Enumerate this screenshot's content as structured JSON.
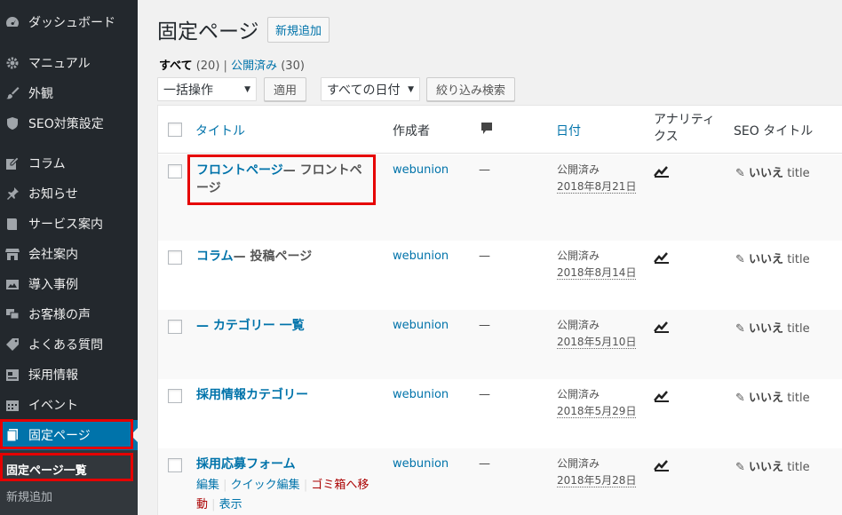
{
  "sidebar": {
    "items": [
      {
        "label": "ダッシュボード",
        "icon": "dashboard-icon"
      },
      {
        "label": "マニュアル",
        "icon": "gear-icon"
      },
      {
        "label": "外観",
        "icon": "paintbrush-icon"
      },
      {
        "label": "SEO対策設定",
        "icon": "shield-icon"
      },
      {
        "label": "コラム",
        "icon": "edit-icon"
      },
      {
        "label": "お知らせ",
        "icon": "pin-icon"
      },
      {
        "label": "サービス案内",
        "icon": "book-icon"
      },
      {
        "label": "会社案内",
        "icon": "store-icon"
      },
      {
        "label": "導入事例",
        "icon": "images-icon"
      },
      {
        "label": "お客様の声",
        "icon": "chat-icon"
      },
      {
        "label": "よくある質問",
        "icon": "tag-icon"
      },
      {
        "label": "採用情報",
        "icon": "id-card-icon"
      },
      {
        "label": "イベント",
        "icon": "calendar-icon"
      },
      {
        "label": "固定ページ",
        "icon": "pages-icon"
      }
    ],
    "submenu": {
      "all_pages": "固定ページ一覧",
      "add_new": "新規追加"
    }
  },
  "header": {
    "title": "固定ページ",
    "add_new": "新規追加"
  },
  "filters": {
    "all": "すべて",
    "all_count": "(20)",
    "sep": "|",
    "published": "公開済み",
    "published_count": "(30)",
    "bulk_action": "一括操作",
    "apply": "適用",
    "all_dates": "すべての日付",
    "filter": "絞り込み検索"
  },
  "table": {
    "columns": {
      "title": "タイトル",
      "author": "作成者",
      "comments_icon": "comment-icon",
      "date": "日付",
      "analytics": "アナリティクス",
      "seo": "SEO タイトル"
    },
    "rows": [
      {
        "title": "フロントページ",
        "state": "— フロントページ",
        "author": "webunion",
        "comments": "—",
        "status": "公開済み",
        "date": "2018年8月21日",
        "seo_no": "いいえ",
        "seo_label": "title"
      },
      {
        "title": "コラム",
        "state": "— 投稿ページ",
        "author": "webunion",
        "comments": "—",
        "status": "公開済み",
        "date": "2018年8月14日",
        "seo_no": "いいえ",
        "seo_label": "title"
      },
      {
        "title": "— カテゴリー 一覧",
        "state": "",
        "author": "webunion",
        "comments": "—",
        "status": "公開済み",
        "date": "2018年5月10日",
        "seo_no": "いいえ",
        "seo_label": "title"
      },
      {
        "title": "採用情報カテゴリー",
        "state": "",
        "author": "webunion",
        "comments": "—",
        "status": "公開済み",
        "date": "2018年5月29日",
        "seo_no": "いいえ",
        "seo_label": "title"
      },
      {
        "title": "採用応募フォーム",
        "state": "",
        "author": "webunion",
        "comments": "—",
        "status": "公開済み",
        "date": "2018年5月28日",
        "seo_no": "いいえ",
        "seo_label": "title"
      }
    ],
    "row_actions": {
      "edit": "編集",
      "quick_edit": "クイック編集",
      "trash": "ゴミ箱へ移動",
      "view": "表示"
    }
  },
  "colors": {
    "sidebar_bg": "#23282d",
    "accent": "#0073aa",
    "highlight_box": "#e60000"
  }
}
